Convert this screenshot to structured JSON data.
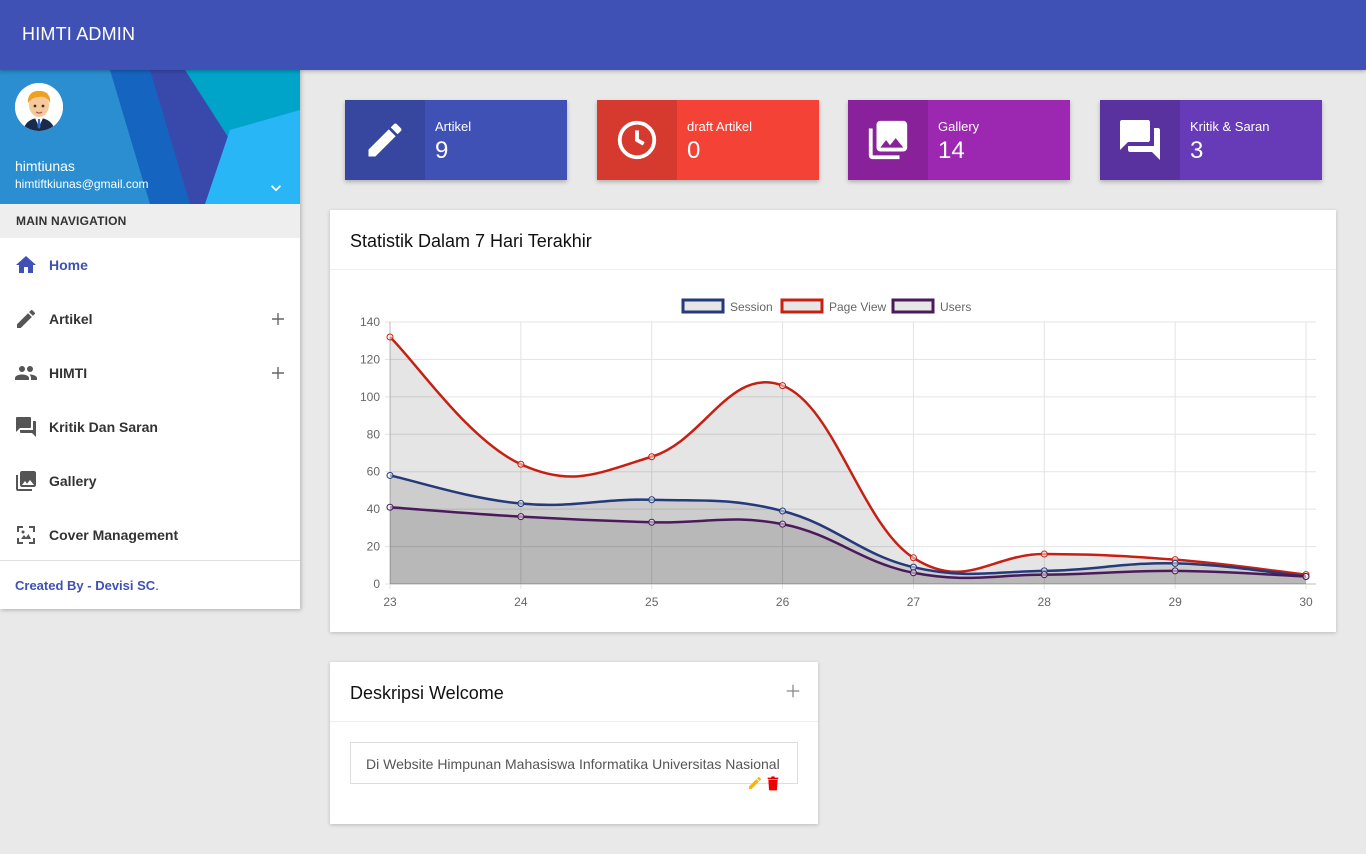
{
  "app": {
    "title": "HIMTI ADMIN"
  },
  "user": {
    "name": "himtiunas",
    "email": "himtiftkiunas@gmail.com"
  },
  "nav": {
    "header": "MAIN NAVIGATION",
    "items": [
      {
        "label": "Home",
        "icon": "home-icon"
      },
      {
        "label": "Artikel",
        "icon": "pencil-icon"
      },
      {
        "label": "HIMTI",
        "icon": "people-icon"
      },
      {
        "label": "Kritik Dan Saran",
        "icon": "forum-icon"
      },
      {
        "label": "Gallery",
        "icon": "gallery-icon"
      },
      {
        "label": "Cover Management",
        "icon": "image-icon"
      }
    ],
    "footer_prefix": "Created By - ",
    "footer_link": "Devisi SC",
    "footer_suffix": "."
  },
  "stats": [
    {
      "title": "Artikel",
      "value": "9",
      "color": "#3f51b5",
      "icon": "pencil-icon"
    },
    {
      "title": "draft Artikel",
      "value": "0",
      "color": "#f44336",
      "icon": "clock-icon"
    },
    {
      "title": "Gallery",
      "value": "14",
      "color": "#9c27b0",
      "icon": "gallery-icon"
    },
    {
      "title": "Kritik & Saran",
      "value": "3",
      "color": "#673ab7",
      "icon": "forum-icon"
    }
  ],
  "chart_card": {
    "title": "Statistik Dalam 7 Hari Terakhir"
  },
  "chart_data": {
    "type": "area",
    "x": [
      "23",
      "24",
      "25",
      "26",
      "27",
      "28",
      "29",
      "30"
    ],
    "ylim": [
      0,
      140
    ],
    "yticks": [
      0,
      20,
      40,
      60,
      80,
      100,
      120,
      140
    ],
    "grid": true,
    "legend_position": "top",
    "series": [
      {
        "name": "Session",
        "color": "#243a7a",
        "values": [
          58,
          43,
          45,
          39,
          9,
          7,
          11,
          4
        ]
      },
      {
        "name": "Page View",
        "color": "#c62013",
        "values": [
          132,
          64,
          68,
          106,
          14,
          16,
          13,
          5
        ]
      },
      {
        "name": "Users",
        "color": "#4a1a5c",
        "values": [
          41,
          36,
          33,
          32,
          6,
          5,
          7,
          4
        ]
      }
    ]
  },
  "welcome_card": {
    "title": "Deskripsi Welcome",
    "text": "Di Website Himpunan Mahasiswa Informatika Universitas Nasional"
  }
}
